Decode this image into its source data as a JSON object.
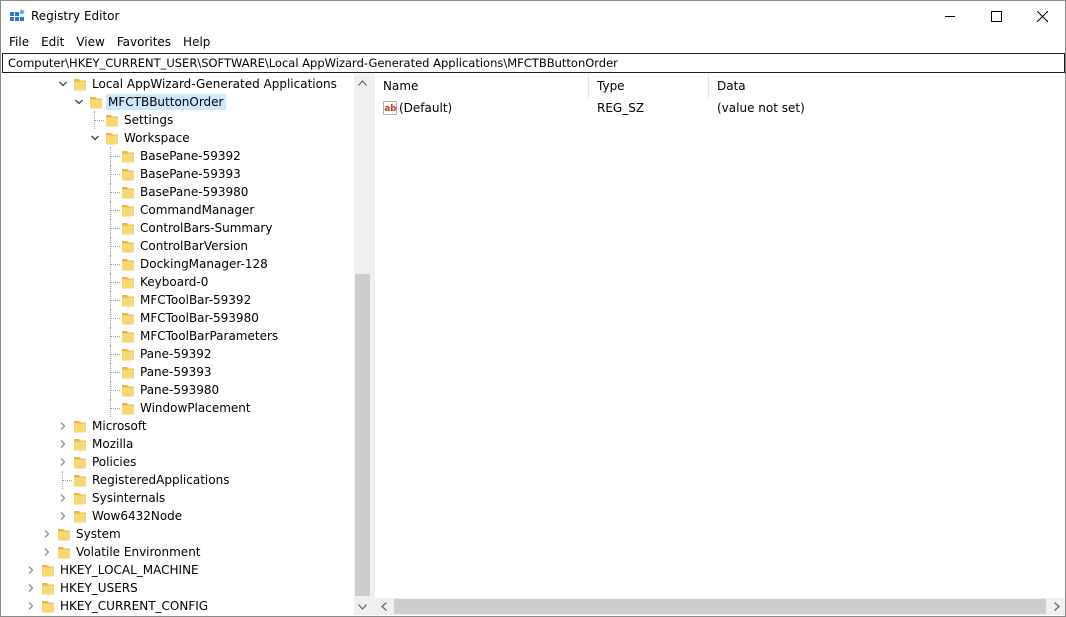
{
  "window": {
    "title": "Registry Editor"
  },
  "menu": [
    "File",
    "Edit",
    "View",
    "Favorites",
    "Help"
  ],
  "address": "Computer\\HKEY_CURRENT_USER\\SOFTWARE\\Local AppWizard-Generated Applications\\MFCTBButtonOrder",
  "tree": [
    {
      "label": "Local AppWizard-Generated Applications",
      "level": 3,
      "state": "expanded"
    },
    {
      "label": "MFCTBButtonOrder",
      "level": 4,
      "state": "expanded",
      "selected": true
    },
    {
      "label": "Settings",
      "level": 5,
      "state": "leaf"
    },
    {
      "label": "Workspace",
      "level": 5,
      "state": "expanded"
    },
    {
      "label": "BasePane-59392",
      "level": 6,
      "state": "leaf"
    },
    {
      "label": "BasePane-59393",
      "level": 6,
      "state": "leaf"
    },
    {
      "label": "BasePane-593980",
      "level": 6,
      "state": "leaf"
    },
    {
      "label": "CommandManager",
      "level": 6,
      "state": "leaf"
    },
    {
      "label": "ControlBars-Summary",
      "level": 6,
      "state": "leaf"
    },
    {
      "label": "ControlBarVersion",
      "level": 6,
      "state": "leaf"
    },
    {
      "label": "DockingManager-128",
      "level": 6,
      "state": "leaf"
    },
    {
      "label": "Keyboard-0",
      "level": 6,
      "state": "leaf"
    },
    {
      "label": "MFCToolBar-59392",
      "level": 6,
      "state": "leaf"
    },
    {
      "label": "MFCToolBar-593980",
      "level": 6,
      "state": "leaf"
    },
    {
      "label": "MFCToolBarParameters",
      "level": 6,
      "state": "leaf"
    },
    {
      "label": "Pane-59392",
      "level": 6,
      "state": "leaf"
    },
    {
      "label": "Pane-59393",
      "level": 6,
      "state": "leaf"
    },
    {
      "label": "Pane-593980",
      "level": 6,
      "state": "leaf"
    },
    {
      "label": "WindowPlacement",
      "level": 6,
      "state": "leaf"
    },
    {
      "label": "Microsoft",
      "level": 3,
      "state": "collapsed"
    },
    {
      "label": "Mozilla",
      "level": 3,
      "state": "collapsed"
    },
    {
      "label": "Policies",
      "level": 3,
      "state": "collapsed"
    },
    {
      "label": "RegisteredApplications",
      "level": 3,
      "state": "leaf"
    },
    {
      "label": "Sysinternals",
      "level": 3,
      "state": "collapsed"
    },
    {
      "label": "Wow6432Node",
      "level": 3,
      "state": "collapsed"
    },
    {
      "label": "System",
      "level": 2,
      "state": "collapsed"
    },
    {
      "label": "Volatile Environment",
      "level": 2,
      "state": "collapsed"
    },
    {
      "label": "HKEY_LOCAL_MACHINE",
      "level": 1,
      "state": "collapsed"
    },
    {
      "label": "HKEY_USERS",
      "level": 1,
      "state": "collapsed"
    },
    {
      "label": "HKEY_CURRENT_CONFIG",
      "level": 1,
      "state": "collapsed"
    }
  ],
  "list": {
    "columns": [
      "Name",
      "Type",
      "Data"
    ],
    "rows": [
      {
        "name": "(Default)",
        "type": "REG_SZ",
        "data": "(value not set)",
        "icon": "string-value-icon"
      }
    ]
  },
  "icons": {
    "app": "registry-editor-icon",
    "folder": "folder-icon",
    "minimize": "minimize-icon",
    "maximize": "maximize-icon",
    "close": "close-icon"
  },
  "colors": {
    "folder": "#f8d775",
    "selection": "#cce8ff",
    "scrollbar": "#f0f0f0",
    "scroll_thumb": "#cdcdcd"
  }
}
